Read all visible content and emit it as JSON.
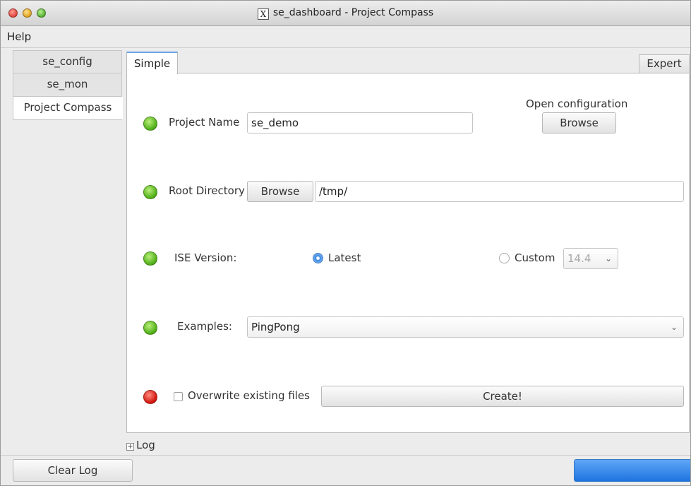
{
  "window": {
    "title": "se_dashboard - Project Compass",
    "x_badge": "X"
  },
  "menu": {
    "help": "Help"
  },
  "left_tabs": [
    {
      "label": "se_config",
      "active": false
    },
    {
      "label": "se_mon",
      "active": false
    },
    {
      "label": "Project Compass",
      "active": true
    }
  ],
  "tabs": {
    "simple": "Simple",
    "expert": "Expert"
  },
  "form": {
    "open_config_label": "Open configuration",
    "open_config_button": "Browse",
    "project_name_label": "Project Name",
    "project_name_value": "se_demo",
    "root_dir_label": "Root Directory",
    "root_dir_button": "Browse",
    "root_dir_value": "/tmp/",
    "ise_label": "ISE Version:",
    "ise_latest_label": "Latest",
    "ise_custom_label": "Custom",
    "ise_custom_value": "14.4",
    "ise_selected": "Latest",
    "examples_label": "Examples:",
    "examples_value": "PingPong",
    "overwrite_label": "Overwrite existing files",
    "overwrite_checked": false,
    "create_button": "Create!"
  },
  "status_leds": {
    "project_name": "green",
    "root_directory": "green",
    "ise_version": "green",
    "examples": "green",
    "create": "red"
  },
  "log": {
    "toggle_label": "Log"
  },
  "bottom": {
    "clear_log": "Clear Log",
    "progress_fraction": 1.0
  },
  "colors": {
    "accent": "#2f76c9",
    "led_green": "#54b21c",
    "led_red": "#d41b12"
  }
}
